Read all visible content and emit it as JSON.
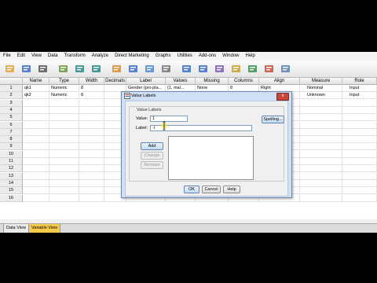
{
  "menu": [
    "File",
    "Edit",
    "View",
    "Data",
    "Transform",
    "Analyze",
    "Direct Marketing",
    "Graphs",
    "Utilities",
    "Add-ons",
    "Window",
    "Help"
  ],
  "toolbar_icons": [
    "open-folder-icon",
    "save-icon",
    "print-icon",
    "dialog-recall-icon",
    "undo-icon",
    "redo-icon",
    "goto-case-icon",
    "goto-variable-icon",
    "variables-icon",
    "find-icon",
    "insert-cases-icon",
    "insert-variable-icon",
    "split-file-icon",
    "weight-cases-icon",
    "select-cases-icon",
    "value-labels-icon",
    "use-sets-icon"
  ],
  "grid": {
    "columns": [
      "Name",
      "Type",
      "Width",
      "Decimals",
      "Label",
      "Values",
      "Missing",
      "Columns",
      "Align",
      "Measure",
      "Role"
    ],
    "row_numbers": [
      "1",
      "2",
      "3",
      "4",
      "5",
      "6",
      "7",
      "8",
      "9",
      "10",
      "11",
      "12",
      "13",
      "14",
      "15",
      "16"
    ],
    "rows": [
      {
        "name": "qk1",
        "type": "Numeric",
        "width": "8",
        "decimals": "",
        "label": "Gender (pro pla...",
        "values": "{1, mal...",
        "missing": "None",
        "columns": "8",
        "align": "Right",
        "measure": "Nominal",
        "role": "Input"
      },
      {
        "name": "qk2",
        "type": "Numeric",
        "width": "8",
        "decimals": "",
        "label": "",
        "values": "",
        "missing": "None",
        "columns": "8",
        "align": "Right",
        "measure": "Unknown",
        "role": "Input"
      }
    ]
  },
  "tabs": {
    "data_view": "Data View",
    "variable_view": "Variable View"
  },
  "dialog": {
    "title": "Value Labels",
    "group_label": "Value Labels",
    "value_label": "Value:",
    "value": "1",
    "label_label": "Label:",
    "label_value": "-l",
    "spelling": "Spelling...",
    "add": "Add",
    "change": "Change",
    "remove": "Remove",
    "ok": "OK",
    "cancel": "Cancel",
    "help": "Help",
    "close": "x"
  }
}
